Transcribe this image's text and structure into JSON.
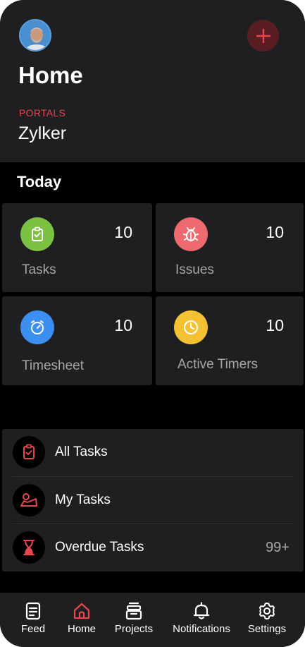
{
  "header": {
    "title": "Home",
    "portals_label": "PORTALS",
    "portal_name": "Zylker"
  },
  "today": {
    "label": "Today",
    "cards": [
      {
        "label": "Tasks",
        "count": "10",
        "icon": "clipboard-check-icon",
        "color": "#7cc142"
      },
      {
        "label": "Issues",
        "count": "10",
        "icon": "bug-icon",
        "color": "#ee6a6f"
      },
      {
        "label": "Timesheet",
        "count": "10",
        "icon": "stopwatch-icon",
        "color": "#3a8ff0"
      },
      {
        "label": "Active Timers",
        "count": "10",
        "icon": "clock-icon",
        "color": "#f3c131"
      }
    ]
  },
  "lists": [
    {
      "label": "All Tasks",
      "icon": "clipboard-check-icon",
      "badge": ""
    },
    {
      "label": "My Tasks",
      "icon": "user-task-icon",
      "badge": ""
    },
    {
      "label": "Overdue Tasks",
      "icon": "hourglass-icon",
      "badge": "99+"
    }
  ],
  "tabs": [
    {
      "label": "Feed",
      "icon": "feed-icon"
    },
    {
      "label": "Home",
      "icon": "home-icon"
    },
    {
      "label": "Projects",
      "icon": "projects-icon"
    },
    {
      "label": "Notifications",
      "icon": "bell-icon"
    },
    {
      "label": "Settings",
      "icon": "gear-icon"
    }
  ],
  "colors": {
    "accent": "#e8454f",
    "surface": "#1f1f21",
    "background": "#000000"
  }
}
